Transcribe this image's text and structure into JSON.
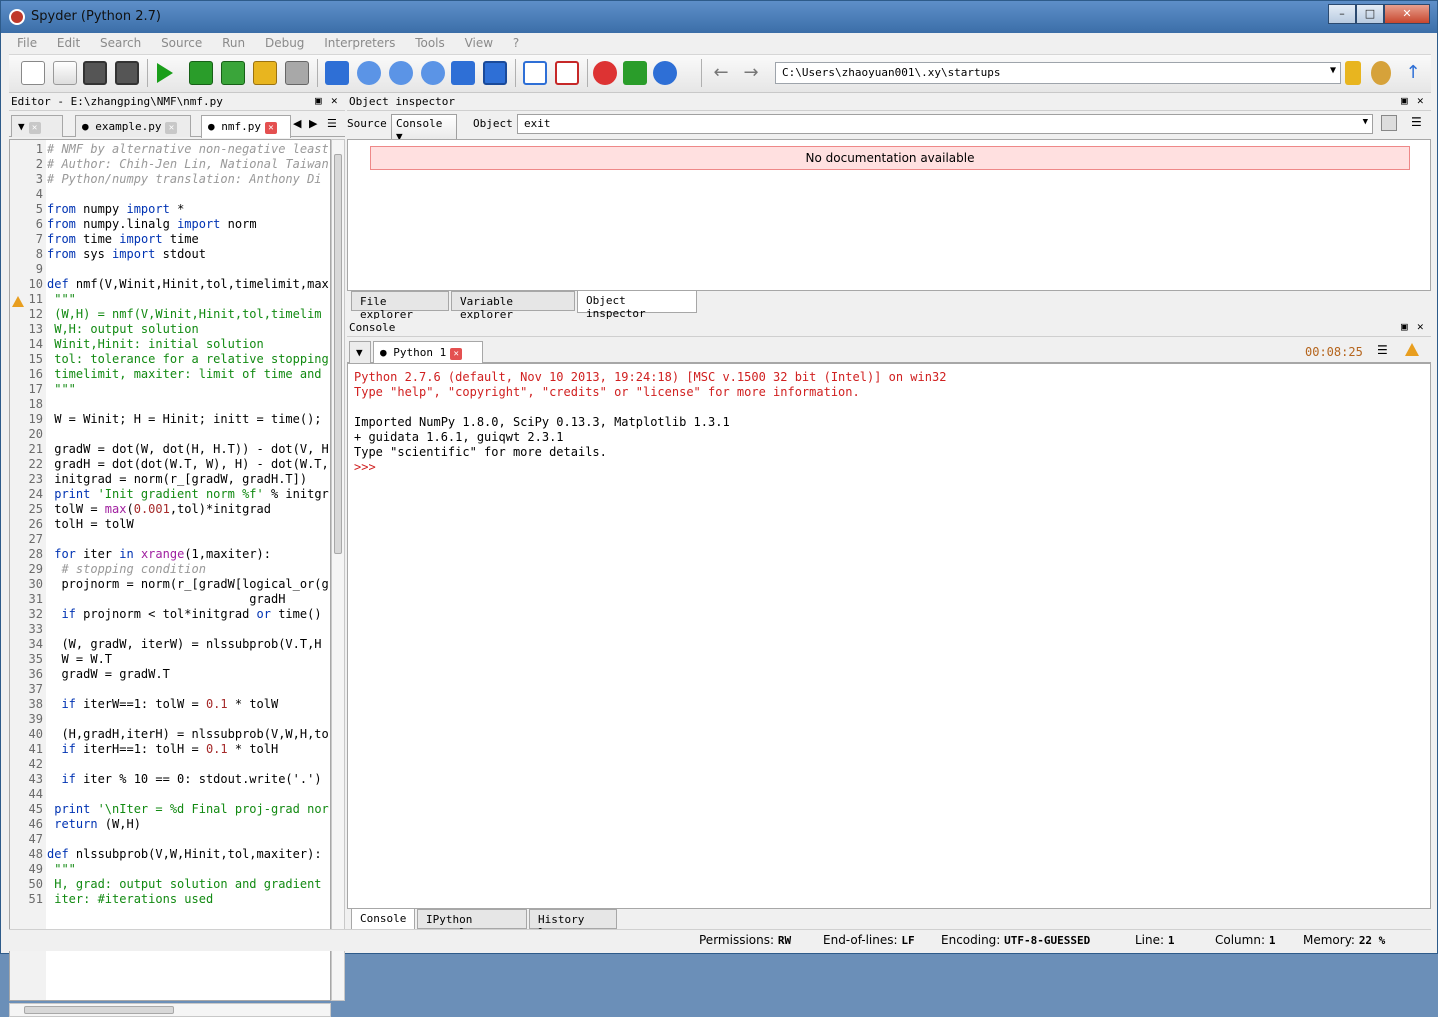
{
  "window": {
    "title": "Spyder (Python 2.7)",
    "min": "–",
    "max": "□",
    "close": "✕"
  },
  "menu": [
    "File",
    "Edit",
    "Search",
    "Source",
    "Run",
    "Debug",
    "Interpreters",
    "Tools",
    "View",
    "?"
  ],
  "toolbar": {
    "path": "C:\\Users\\zhaoyuan001\\.xy\\startups",
    "icons": [
      "new-file-icon",
      "open-file-icon",
      "save-icon",
      "save-all-icon",
      "run-icon",
      "run-selection-icon",
      "run-config-icon",
      "debug-icon",
      "profile-icon",
      "debug-step-icon",
      "step-into-icon",
      "step-over-icon",
      "step-return-icon",
      "continue-icon",
      "stop-icon",
      "maximize-pane-icon",
      "fullscreen-icon",
      "tools-icon",
      "python-path-icon",
      "pythonxy-icon",
      "back-icon",
      "forward-icon",
      "browse-folder-icon",
      "set-workdir-icon",
      "parent-dir-icon"
    ],
    "colors": {
      "run": "#1a9e1a",
      "debug": "#2e6fd6",
      "tools": "#d33"
    }
  },
  "editor": {
    "title": "Editor - E:\\zhangping\\NMF\\nmf.py",
    "tabs": [
      {
        "label": "example.py"
      },
      {
        "label": "nmf.py"
      }
    ],
    "lines": [
      {
        "n": "1",
        "t": [
          {
            "c": "cm",
            "s": "# NMF by alternative non-negative least"
          }
        ]
      },
      {
        "n": "2",
        "t": [
          {
            "c": "cm",
            "s": "# Author: Chih-Jen Lin, National Taiwan"
          }
        ]
      },
      {
        "n": "3",
        "t": [
          {
            "c": "cm",
            "s": "# Python/numpy translation: Anthony Di"
          }
        ]
      },
      {
        "n": "4",
        "t": []
      },
      {
        "n": "5",
        "t": [
          {
            "c": "kw",
            "s": "from"
          },
          {
            "c": "",
            "s": " numpy "
          },
          {
            "c": "kw",
            "s": "import"
          },
          {
            "c": "",
            "s": " *"
          }
        ]
      },
      {
        "n": "6",
        "t": [
          {
            "c": "kw",
            "s": "from"
          },
          {
            "c": "",
            "s": " numpy.linalg "
          },
          {
            "c": "kw",
            "s": "import"
          },
          {
            "c": "",
            "s": " norm"
          }
        ]
      },
      {
        "n": "7",
        "t": [
          {
            "c": "kw",
            "s": "from"
          },
          {
            "c": "",
            "s": " time "
          },
          {
            "c": "kw",
            "s": "import"
          },
          {
            "c": "",
            "s": " time"
          }
        ]
      },
      {
        "n": "8",
        "t": [
          {
            "c": "kw",
            "s": "from"
          },
          {
            "c": "",
            "s": " sys "
          },
          {
            "c": "kw",
            "s": "import"
          },
          {
            "c": "",
            "s": " stdout"
          }
        ]
      },
      {
        "n": "9",
        "t": []
      },
      {
        "n": "10",
        "t": [
          {
            "c": "kw",
            "s": "def"
          },
          {
            "c": "",
            "s": " nmf(V,Winit,Hinit,tol,timelimit,max"
          }
        ]
      },
      {
        "n": "11",
        "t": [
          {
            "c": "str",
            "s": " \"\"\""
          }
        ]
      },
      {
        "n": "12",
        "t": [
          {
            "c": "str",
            "s": " (W,H) = nmf(V,Winit,Hinit,tol,timelim"
          }
        ]
      },
      {
        "n": "13",
        "t": [
          {
            "c": "str",
            "s": " W,H: output solution"
          }
        ]
      },
      {
        "n": "14",
        "t": [
          {
            "c": "str",
            "s": " Winit,Hinit: initial solution"
          }
        ]
      },
      {
        "n": "15",
        "t": [
          {
            "c": "str",
            "s": " tol: tolerance for a relative stopping"
          }
        ]
      },
      {
        "n": "16",
        "t": [
          {
            "c": "str",
            "s": " timelimit, maxiter: limit of time and"
          }
        ]
      },
      {
        "n": "17",
        "t": [
          {
            "c": "str",
            "s": " \"\"\""
          }
        ]
      },
      {
        "n": "18",
        "t": []
      },
      {
        "n": "19",
        "t": [
          {
            "c": "",
            "s": " W = Winit; H = Hinit; initt = time();"
          }
        ]
      },
      {
        "n": "20",
        "t": []
      },
      {
        "n": "21",
        "t": [
          {
            "c": "",
            "s": " gradW = dot(W, dot(H, H.T)) - dot(V, H"
          }
        ]
      },
      {
        "n": "22",
        "t": [
          {
            "c": "",
            "s": " gradH = dot(dot(W.T, W), H) - dot(W.T,"
          }
        ]
      },
      {
        "n": "23",
        "t": [
          {
            "c": "",
            "s": " initgrad = norm(r_[gradW, gradH.T])"
          }
        ]
      },
      {
        "n": "24",
        "t": [
          {
            "c": "kw",
            "s": " print"
          },
          {
            "c": "str",
            "s": " 'Init gradient norm %f'"
          },
          {
            "c": "",
            "s": " % initgr"
          }
        ]
      },
      {
        "n": "25",
        "t": [
          {
            "c": "",
            "s": " tolW = "
          },
          {
            "c": "bi",
            "s": "max"
          },
          {
            "c": "",
            "s": "("
          },
          {
            "c": "num",
            "s": "0.001"
          },
          {
            "c": "",
            "s": ",tol)*initgrad"
          }
        ]
      },
      {
        "n": "26",
        "t": [
          {
            "c": "",
            "s": " tolH = tolW"
          }
        ]
      },
      {
        "n": "27",
        "t": []
      },
      {
        "n": "28",
        "t": [
          {
            "c": "kw",
            "s": " for"
          },
          {
            "c": "",
            "s": " iter "
          },
          {
            "c": "kw",
            "s": "in"
          },
          {
            "c": "",
            "s": " "
          },
          {
            "c": "bi",
            "s": "xrange"
          },
          {
            "c": "",
            "s": "(1,maxiter):"
          }
        ]
      },
      {
        "n": "29",
        "t": [
          {
            "c": "cm",
            "s": "  # stopping condition"
          }
        ]
      },
      {
        "n": "30",
        "t": [
          {
            "c": "",
            "s": "  projnorm = norm(r_[gradW[logical_or(g"
          }
        ]
      },
      {
        "n": "31",
        "t": [
          {
            "c": "",
            "s": "                            gradH"
          }
        ]
      },
      {
        "n": "32",
        "t": [
          {
            "c": "kw",
            "s": "  if"
          },
          {
            "c": "",
            "s": " projnorm < tol*initgrad "
          },
          {
            "c": "kw",
            "s": "or"
          },
          {
            "c": "",
            "s": " time()"
          }
        ]
      },
      {
        "n": "33",
        "t": []
      },
      {
        "n": "34",
        "t": [
          {
            "c": "",
            "s": "  (W, gradW, iterW) = nlssubprob(V.T,H"
          }
        ]
      },
      {
        "n": "35",
        "t": [
          {
            "c": "",
            "s": "  W = W.T"
          }
        ]
      },
      {
        "n": "36",
        "t": [
          {
            "c": "",
            "s": "  gradW = gradW.T"
          }
        ]
      },
      {
        "n": "37",
        "t": []
      },
      {
        "n": "38",
        "t": [
          {
            "c": "kw",
            "s": "  if"
          },
          {
            "c": "",
            "s": " iterW==1: tolW = "
          },
          {
            "c": "num",
            "s": "0.1"
          },
          {
            "c": "",
            "s": " * tolW"
          }
        ]
      },
      {
        "n": "39",
        "t": []
      },
      {
        "n": "40",
        "t": [
          {
            "c": "",
            "s": "  (H,gradH,iterH) = nlssubprob(V,W,H,to"
          }
        ]
      },
      {
        "n": "41",
        "t": [
          {
            "c": "kw",
            "s": "  if"
          },
          {
            "c": "",
            "s": " iterH==1: tolH = "
          },
          {
            "c": "num",
            "s": "0.1"
          },
          {
            "c": "",
            "s": " * tolH"
          }
        ]
      },
      {
        "n": "42",
        "t": []
      },
      {
        "n": "43",
        "t": [
          {
            "c": "kw",
            "s": "  if"
          },
          {
            "c": "",
            "s": " iter % 10 == 0: stdout.write('.')"
          }
        ]
      },
      {
        "n": "44",
        "t": []
      },
      {
        "n": "45",
        "t": [
          {
            "c": "kw",
            "s": " print"
          },
          {
            "c": "str",
            "s": " '\\nIter = %d Final proj-grad nor"
          }
        ]
      },
      {
        "n": "46",
        "t": [
          {
            "c": "kw",
            "s": " return"
          },
          {
            "c": "",
            "s": " (W,H)"
          }
        ]
      },
      {
        "n": "47",
        "t": []
      },
      {
        "n": "48",
        "t": [
          {
            "c": "kw",
            "s": "def"
          },
          {
            "c": "",
            "s": " nlssubprob(V,W,Hinit,tol,maxiter):"
          }
        ]
      },
      {
        "n": "49",
        "t": [
          {
            "c": "str",
            "s": " \"\"\""
          }
        ]
      },
      {
        "n": "50",
        "t": [
          {
            "c": "str",
            "s": " H, grad: output solution and gradient"
          }
        ]
      },
      {
        "n": "51",
        "t": [
          {
            "c": "str",
            "s": " iter: #iterations used"
          }
        ]
      }
    ]
  },
  "object_inspector": {
    "title": "Object inspector",
    "source_label": "Source",
    "source_value": "Console",
    "object_label": "Object",
    "object_value": "exit",
    "message": "No documentation available",
    "tabs": [
      "File explorer",
      "Variable explorer",
      "Object inspector"
    ]
  },
  "console": {
    "title": "Console",
    "tab": "Python 1",
    "elapsed": "00:08:25",
    "lines": [
      {
        "c": "red",
        "s": "Python 2.7.6 (default, Nov 10 2013, 19:24:18) [MSC v.1500 32 bit (Intel)] on win32"
      },
      {
        "c": "red",
        "s": "Type \"help\", \"copyright\", \"credits\" or \"license\" for more information."
      },
      {
        "c": "",
        "s": ""
      },
      {
        "c": "",
        "s": "Imported NumPy 1.8.0, SciPy 0.13.3, Matplotlib 1.3.1"
      },
      {
        "c": "",
        "s": "+ guidata 1.6.1, guiqwt 2.3.1"
      },
      {
        "c": "",
        "s": "Type \"scientific\" for more details."
      },
      {
        "c": "red",
        "s": ">>>"
      }
    ],
    "tabs": [
      "Console",
      "IPython console",
      "History log"
    ]
  },
  "status": {
    "permissions_label": "Permissions:",
    "permissions": "RW",
    "eol_label": "End-of-lines:",
    "eol": "LF",
    "encoding_label": "Encoding:",
    "encoding": "UTF-8-GUESSED",
    "line_label": "Line:",
    "line": "1",
    "column_label": "Column:",
    "column": "1",
    "memory_label": "Memory:",
    "memory": "22 %"
  }
}
